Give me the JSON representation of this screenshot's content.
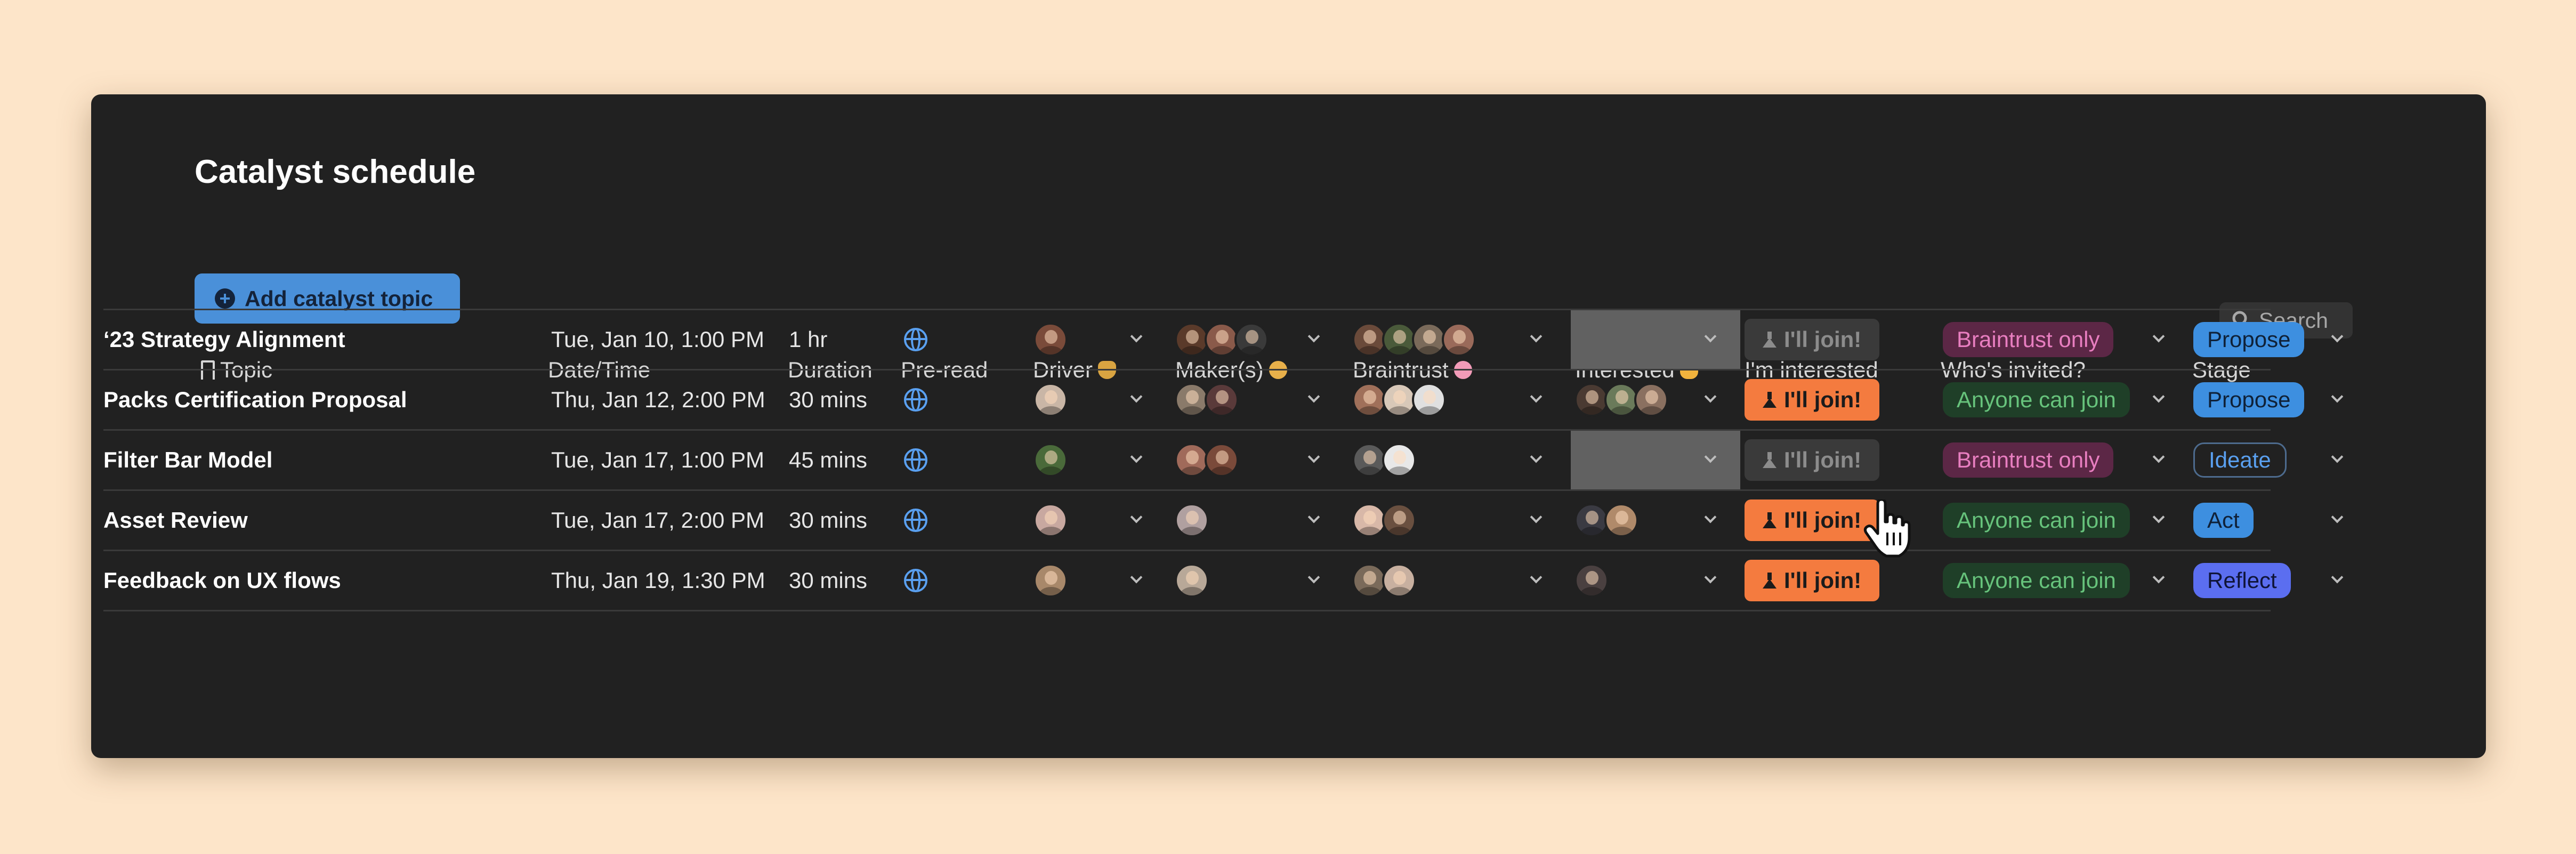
{
  "title": "Catalyst schedule",
  "add_button": "Add catalyst topic",
  "search": {
    "label": "Search"
  },
  "colors": {
    "background": "#fde5c9",
    "card": "#212121",
    "accent": "#4a90d9",
    "join": "#f47b3f"
  },
  "headers": {
    "topic": "Topic",
    "datetime": "Date/Time",
    "duration": "Duration",
    "preread": "Pre-read",
    "driver": "Driver",
    "makers": "Maker(s)",
    "braintrust": "Braintrust",
    "interested": "Interested",
    "im_interested": "I'm interested",
    "invited": "Who's invited?",
    "stage": "Stage"
  },
  "join_label": "I'll join!",
  "rows": [
    {
      "topic": "‘23 Strategy Alignment",
      "datetime": "Tue, Jan 10, 1:00 PM",
      "duration": "1 hr",
      "invited": "Braintrust only",
      "stage": "Propose"
    },
    {
      "topic": "Packs Certification Proposal",
      "datetime": "Thu, Jan 12, 2:00 PM",
      "duration": "30 mins",
      "invited": "Anyone can join",
      "stage": "Propose"
    },
    {
      "topic": "Filter Bar Model",
      "datetime": "Tue, Jan 17, 1:00 PM",
      "duration": "45 mins",
      "invited": "Braintrust only",
      "stage": "Ideate"
    },
    {
      "topic": "Asset Review",
      "datetime": "Tue, Jan 17, 2:00 PM",
      "duration": "30 mins",
      "invited": "Anyone can join",
      "stage": "Act"
    },
    {
      "topic": "Feedback on UX flows",
      "datetime": "Thu, Jan 19, 1:30 PM",
      "duration": "30 mins",
      "invited": "Anyone can join",
      "stage": "Reflect"
    }
  ]
}
